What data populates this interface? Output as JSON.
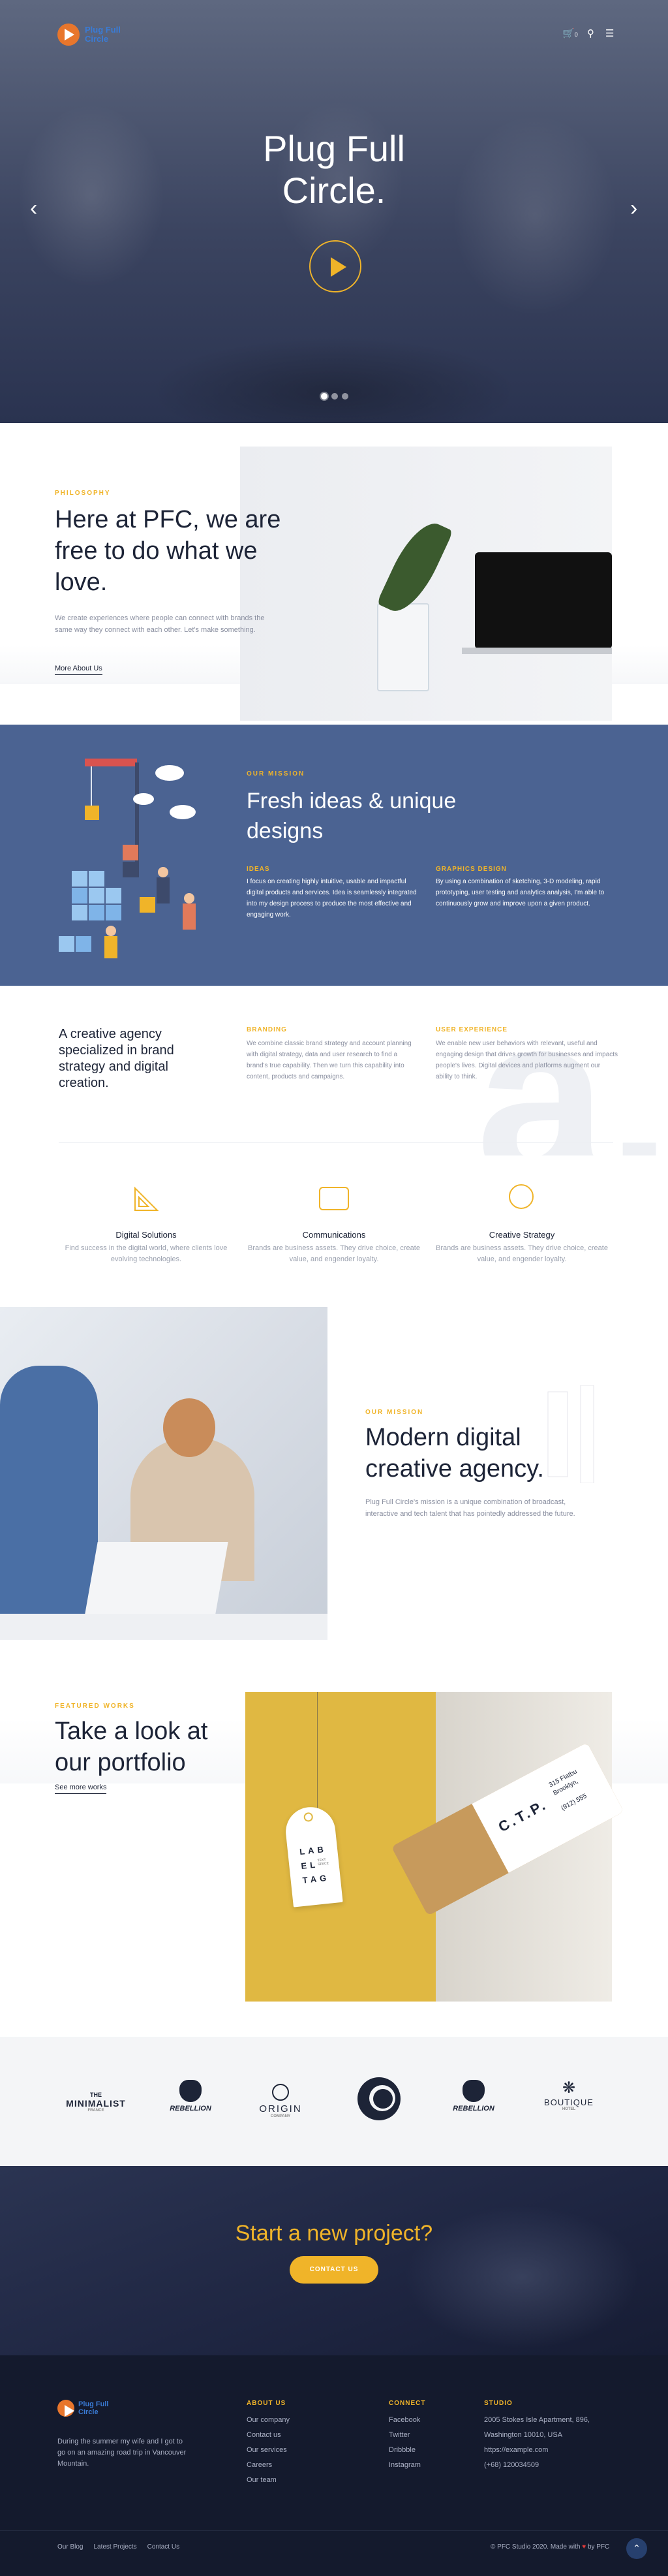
{
  "brand": {
    "logo_line1": "Plug Full",
    "logo_line2": "Circle",
    "cart_count": "0"
  },
  "hero": {
    "title_line1": "Plug Full",
    "title_line2": "Circle."
  },
  "philosophy": {
    "kicker": "PHILOSOPHY",
    "title_line1": "Here at PFC, we are",
    "title_line2": "free to do what we",
    "title_line3": "love.",
    "text": "We create experiences where people can connect with brands the same way they connect with each other. Let's make something.",
    "link": "More About Us"
  },
  "mission": {
    "kicker": "OUR MISSION",
    "title_line1": "Fresh ideas & unique",
    "title_line2": "designs",
    "cols": [
      {
        "title": "IDEAS",
        "text": "I focus on creating highly intuitive, usable and impactful digital products and services. Idea is seamlessly integrated into my design process to produce the most effective and engaging work."
      },
      {
        "title": "GRAPHICS DESIGN",
        "text": "By using a combination of sketching, 3-D modeling, rapid prototyping, user testing and analytics analysis, I'm able to continuously grow and improve upon a given product."
      }
    ]
  },
  "agency": {
    "title": "A creative agency specialized in brand strategy and digital creation.",
    "big_letter": "a.",
    "cols": [
      {
        "title": "BRANDING",
        "text": "We combine classic brand strategy and account planning with digital strategy, data and user research to find a brand's true capability. Then we turn this capability into content, products and campaigns."
      },
      {
        "title": "USER EXPERIENCE",
        "text": "We enable new user behaviors with relevant, useful and engaging design that drives growth for businesses and impacts people's lives. Digital devices and platforms augment our ability to think."
      }
    ]
  },
  "features": [
    {
      "title": "Digital Solutions",
      "text": "Find success in the digital world, where clients love evolving technologies.",
      "icon": "ruler-triangle-icon"
    },
    {
      "title": "Communications",
      "text": "Brands are business assets. They drive choice, create value, and engender loyalty.",
      "icon": "chat-icon"
    },
    {
      "title": "Creative Strategy",
      "text": "Brands are business assets. They drive choice, create value, and engender loyalty.",
      "icon": "bulb-icon"
    }
  ],
  "modern": {
    "kicker": "OUR MISSION",
    "title_line1": "Modern digital",
    "title_line2": "creative agency.",
    "text": "Plug Full Circle's mission is a unique combination of broadcast, interactive and tech talent that has pointedly addressed the future."
  },
  "portfolio": {
    "kicker": "FEATURED WORKS",
    "title_line1": "Take a look at",
    "title_line2": "our portfolio",
    "link": "See more works",
    "tag_lines": [
      "LAB",
      "EL",
      "TAG"
    ],
    "tag_small": "TEXT SPACE",
    "tube_text": "C.T.P.",
    "tube_addr1": "315 Flatbu",
    "tube_addr2": "Brooklyn,",
    "tube_phone": "(912) 555"
  },
  "clients": [
    {
      "line1": "THE",
      "line2": "MINIMALIST",
      "line3": "FRANCE"
    },
    {
      "line1": "",
      "line2": "REBELLION",
      "line3": ""
    },
    {
      "line1": "",
      "line2": "ORIGIN",
      "line3": "COMPANY"
    },
    {
      "line1": "",
      "line2": "",
      "line3": ""
    },
    {
      "line1": "",
      "line2": "REBELLION",
      "line3": ""
    },
    {
      "line1": "",
      "line2": "BOUTIQUE",
      "line3": "HOTEL"
    }
  ],
  "cta": {
    "title": "Start a new project?",
    "button": "CONTACT US"
  },
  "footer": {
    "about_text": "During the summer my wife and I got to go on an amazing road trip in Vancouver Mountain.",
    "about_us": {
      "title": "ABOUT US",
      "items": [
        "Our company",
        "Contact us",
        "Our services",
        "Careers",
        "Our team"
      ]
    },
    "connect": {
      "title": "CONNECT",
      "items": [
        "Facebook",
        "Twitter",
        "Dribbble",
        "Instagram"
      ]
    },
    "studio": {
      "title": "STUDIO",
      "items": [
        "2005 Stokes Isle Apartment, 896,",
        "Washington 10010, USA",
        "https://example.com",
        "(+68) 120034509"
      ]
    },
    "bottom_links": [
      "Our Blog",
      "Latest Projects",
      "Contact Us"
    ],
    "copyright": "© PFC Studio 2020. Made with",
    "copyright_by": "by PFC"
  },
  "colors": {
    "accent": "#f0b429",
    "navy": "#1d2437",
    "mission_bg": "#4b6392",
    "footer_bg": "#141a2d"
  }
}
